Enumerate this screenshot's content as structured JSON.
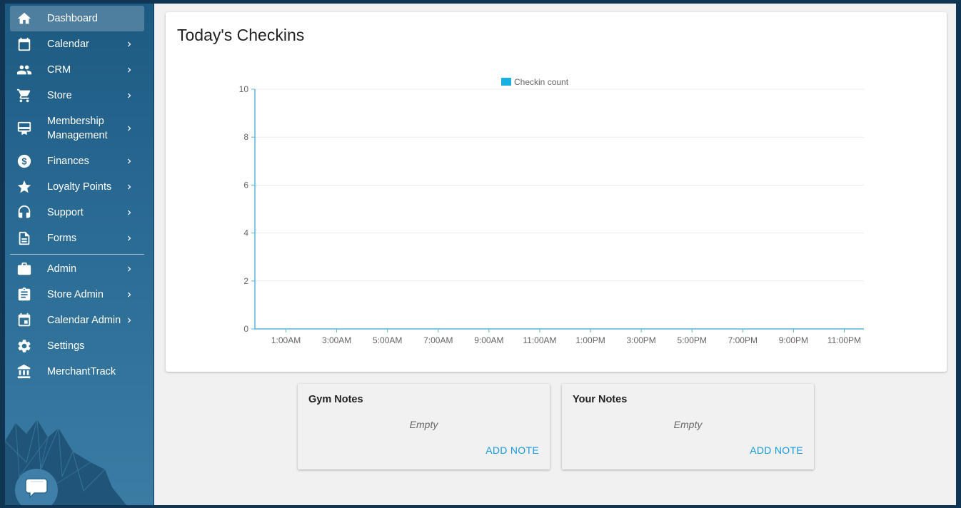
{
  "sidebar": {
    "items": [
      {
        "label": "Dashboard",
        "icon": "home-icon",
        "chevron": false
      },
      {
        "label": "Calendar",
        "icon": "calendar-icon",
        "chevron": true
      },
      {
        "label": "CRM",
        "icon": "people-icon",
        "chevron": true
      },
      {
        "label": "Store",
        "icon": "cart-icon",
        "chevron": true
      },
      {
        "label": "Membership Management",
        "icon": "membership-icon",
        "chevron": true
      },
      {
        "label": "Finances",
        "icon": "dollar-icon",
        "chevron": true
      },
      {
        "label": "Loyalty Points",
        "icon": "star-icon",
        "chevron": true
      },
      {
        "label": "Support",
        "icon": "headset-icon",
        "chevron": true
      },
      {
        "label": "Forms",
        "icon": "document-icon",
        "chevron": true
      },
      {
        "label": "Admin",
        "icon": "briefcase-icon",
        "chevron": true
      },
      {
        "label": "Store Admin",
        "icon": "clipboard-icon",
        "chevron": true
      },
      {
        "label": "Calendar Admin",
        "icon": "calendar-event-icon",
        "chevron": true
      },
      {
        "label": "Settings",
        "icon": "gear-icon",
        "chevron": false
      },
      {
        "label": "MerchantTrack",
        "icon": "bank-icon",
        "chevron": false
      }
    ]
  },
  "checkins": {
    "title": "Today's Checkins"
  },
  "chart_data": {
    "type": "bar",
    "title": "",
    "categories": [
      "1:00AM",
      "3:00AM",
      "5:00AM",
      "7:00AM",
      "9:00AM",
      "11:00AM",
      "1:00PM",
      "3:00PM",
      "5:00PM",
      "7:00PM",
      "9:00PM",
      "11:00PM"
    ],
    "series": [
      {
        "name": "Checkin count",
        "color": "#17b0df",
        "values": [
          0,
          0,
          0,
          0,
          0,
          0,
          0,
          0,
          0,
          0,
          0,
          0
        ]
      }
    ],
    "y_ticks": [
      0,
      2,
      4,
      6,
      8,
      10
    ],
    "ylim": [
      0,
      10
    ],
    "xlabel": "",
    "ylabel": "",
    "grid": true,
    "legend": "top-center"
  },
  "notes": [
    {
      "title": "Gym Notes",
      "empty_text": "Empty",
      "add_label": "ADD NOTE"
    },
    {
      "title": "Your Notes",
      "empty_text": "Empty",
      "add_label": "ADD NOTE"
    }
  ],
  "colors": {
    "accent": "#1a9ad8",
    "axis": "#5ab4d8",
    "sidebar_top": "#1d5a82"
  }
}
